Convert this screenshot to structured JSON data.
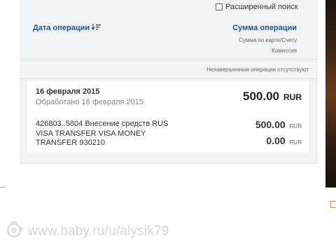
{
  "filter": {
    "advanced_search_label": "Расширенный поиск"
  },
  "columns": {
    "date_header": "Дата операции",
    "sum_header": "Сумма операции",
    "sum_sub1": "Сумма по карте/Счету",
    "sum_sub2": "Комиссия"
  },
  "pending_message": "Незавершенные операции отсутствуют",
  "operation": {
    "date": "16 февраля 2015",
    "processed": "Обработано 16 февраля 2015",
    "amount": "500.00",
    "currency": "RUR",
    "description": [
      "426803..5804 Внесение средств RUS",
      "VISA TRANSFER VISA MONEY",
      "TRANSFER 930210"
    ],
    "card_amount": "500.00",
    "card_currency": "RUR",
    "commission": "0.00",
    "commission_currency": "RUR"
  },
  "watermark": "www.baby.ru/u/alysik79",
  "colors": {
    "link": "#1f4f9f",
    "panel_bg": "#f2f3f5"
  },
  "icons": {
    "sort": "sort-desc-icon",
    "checkbox": "checkbox-icon",
    "watermark_logo": "baby-logo-icon"
  }
}
